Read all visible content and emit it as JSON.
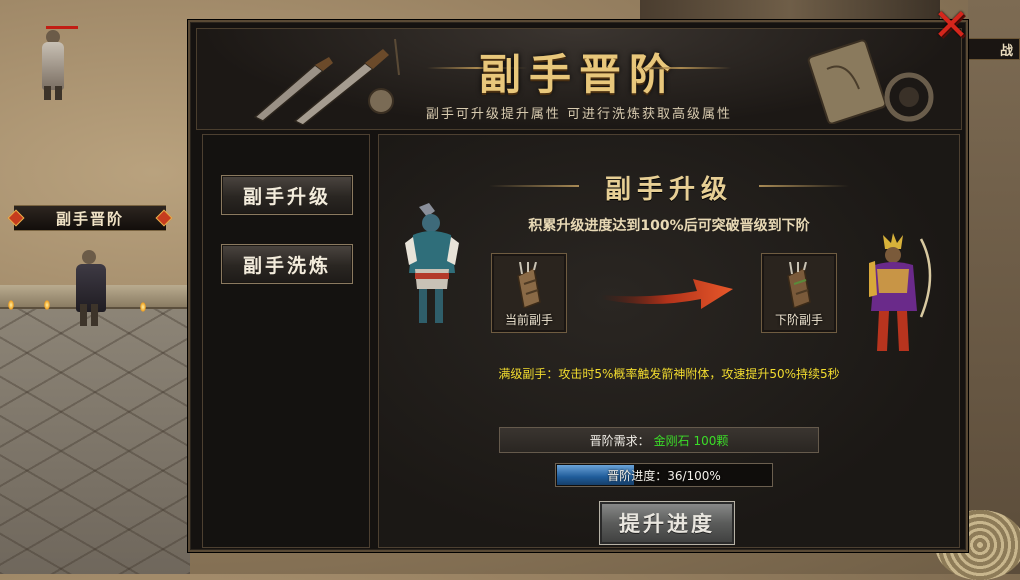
{
  "world": {
    "npc_label": "副手晋阶",
    "battle_tag": "战"
  },
  "panel": {
    "title": "副手晋阶",
    "subtitle": "副手可升级提升属性 可进行洗炼获取高级属性",
    "close_icon": "x-close-icon"
  },
  "menu": {
    "items": [
      {
        "label": "副手升级"
      },
      {
        "label": "副手洗炼"
      }
    ]
  },
  "upgrade": {
    "title": "副手升级",
    "description": "积累升级进度达到100%后可突破晋级到下阶",
    "current_slot_label": "当前副手",
    "next_slot_label": "下阶副手",
    "max_effect": "满级副手：攻击时5%概率触发箭神附体，攻速提升50%持续5秒",
    "requirement_label": "晋阶需求：",
    "requirement_value": "金刚石 100颗",
    "progress_label": "晋阶进度：36/100%",
    "progress_value": 0.36,
    "button_label": "提升进度"
  },
  "colors": {
    "title_gold": "#e8c77b",
    "effect_yellow": "#f2dc2f",
    "requirement_green": "#3bdc28",
    "close_red": "#d4261c",
    "progress_blue": "#1f5c9a"
  }
}
